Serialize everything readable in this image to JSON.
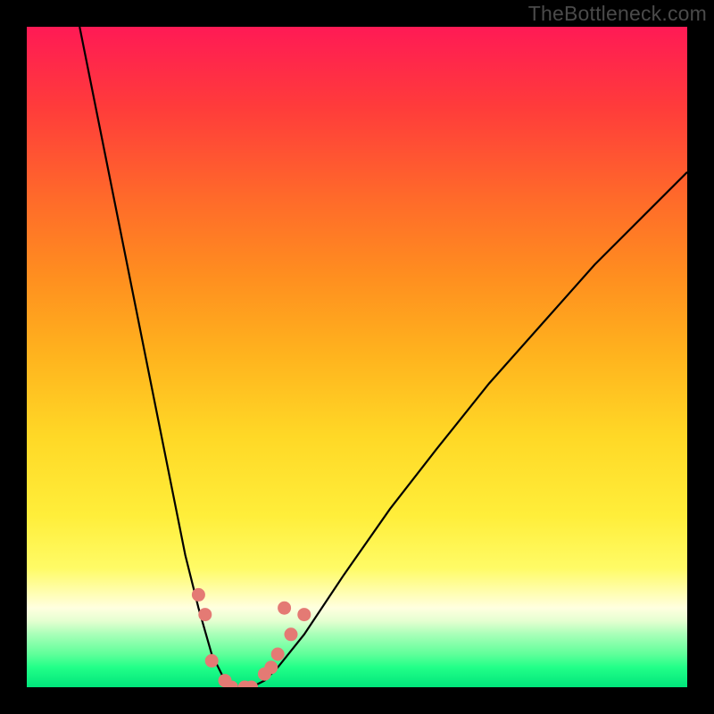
{
  "watermark": "TheBottleneck.com",
  "colors": {
    "curve": "#000000",
    "dot": "#e47a74",
    "frame_bg": "#000000"
  },
  "chart_data": {
    "type": "line",
    "title": "",
    "xlabel": "",
    "ylabel": "",
    "xlim": [
      0,
      100
    ],
    "ylim": [
      0,
      100
    ],
    "grid": false,
    "curves": {
      "left": [
        {
          "x": 8,
          "y": 100
        },
        {
          "x": 10,
          "y": 90
        },
        {
          "x": 12,
          "y": 80
        },
        {
          "x": 14,
          "y": 70
        },
        {
          "x": 16,
          "y": 60
        },
        {
          "x": 18,
          "y": 50
        },
        {
          "x": 20,
          "y": 40
        },
        {
          "x": 22,
          "y": 30
        },
        {
          "x": 24,
          "y": 20
        },
        {
          "x": 26,
          "y": 12
        },
        {
          "x": 28,
          "y": 5
        },
        {
          "x": 30,
          "y": 1
        },
        {
          "x": 32,
          "y": 0
        }
      ],
      "right": [
        {
          "x": 32,
          "y": 0
        },
        {
          "x": 34,
          "y": 0
        },
        {
          "x": 36,
          "y": 1
        },
        {
          "x": 38,
          "y": 3
        },
        {
          "x": 42,
          "y": 8
        },
        {
          "x": 48,
          "y": 17
        },
        {
          "x": 55,
          "y": 27
        },
        {
          "x": 62,
          "y": 36
        },
        {
          "x": 70,
          "y": 46
        },
        {
          "x": 78,
          "y": 55
        },
        {
          "x": 86,
          "y": 64
        },
        {
          "x": 94,
          "y": 72
        },
        {
          "x": 100,
          "y": 78
        }
      ]
    },
    "dots": [
      {
        "x": 26,
        "y": 14
      },
      {
        "x": 27,
        "y": 11
      },
      {
        "x": 28,
        "y": 4
      },
      {
        "x": 30,
        "y": 1
      },
      {
        "x": 31,
        "y": 0
      },
      {
        "x": 33,
        "y": 0
      },
      {
        "x": 34,
        "y": 0
      },
      {
        "x": 36,
        "y": 2
      },
      {
        "x": 37,
        "y": 3
      },
      {
        "x": 38,
        "y": 5
      },
      {
        "x": 40,
        "y": 8
      },
      {
        "x": 42,
        "y": 11
      },
      {
        "x": 39,
        "y": 12
      }
    ]
  }
}
